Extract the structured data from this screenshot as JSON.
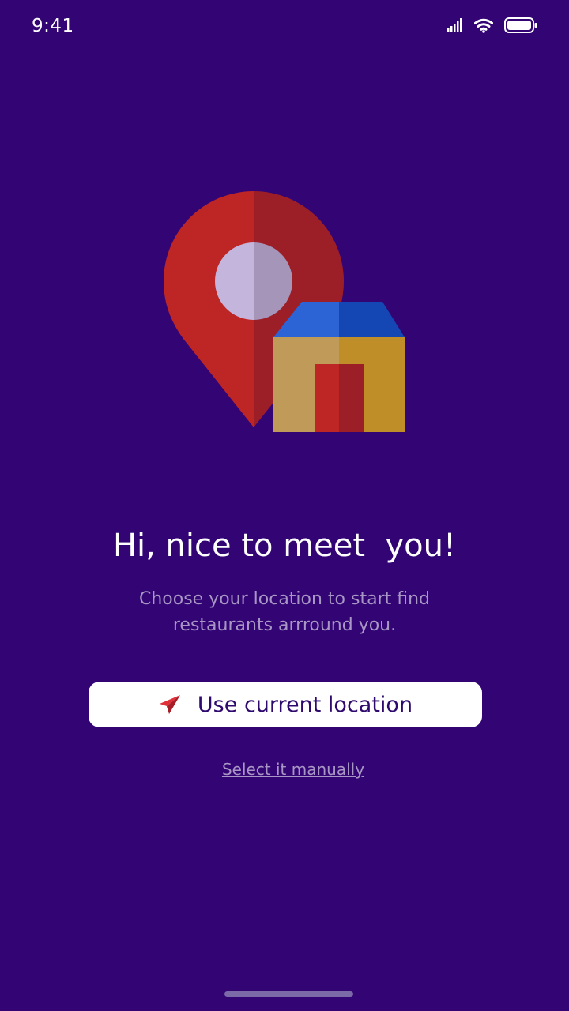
{
  "status_bar": {
    "time": "9:41",
    "icons": [
      "signal-icon",
      "wifi-icon",
      "battery-icon"
    ]
  },
  "illustration": {
    "icons": [
      "location-pin-icon",
      "house-icon"
    ],
    "colors": {
      "pin_light": "#be2626",
      "pin_dark": "#9c1f28",
      "pin_dot_light": "#c4b5dd",
      "pin_dot_dark": "#a595b9",
      "roof_light": "#2c64d6",
      "roof_dark": "#1447b4",
      "wall_light": "#bf9a59",
      "wall_dark": "#bf8e28",
      "door_light": "#be2626",
      "door_dark": "#9c1f28"
    }
  },
  "onboarding": {
    "headline": "Hi, nice to meet  you!",
    "subtitle": "Choose your location to start find restaurants arrround you.",
    "primary_button": {
      "label": "Use current location",
      "icon": "paper-plane-icon"
    },
    "secondary_link": "Select it manually"
  },
  "theme": {
    "background": "#330474",
    "button_background": "#ffffff",
    "button_text": "#2f0a6e",
    "muted_text": "#a896c4",
    "accent_red": "#c0232b"
  }
}
